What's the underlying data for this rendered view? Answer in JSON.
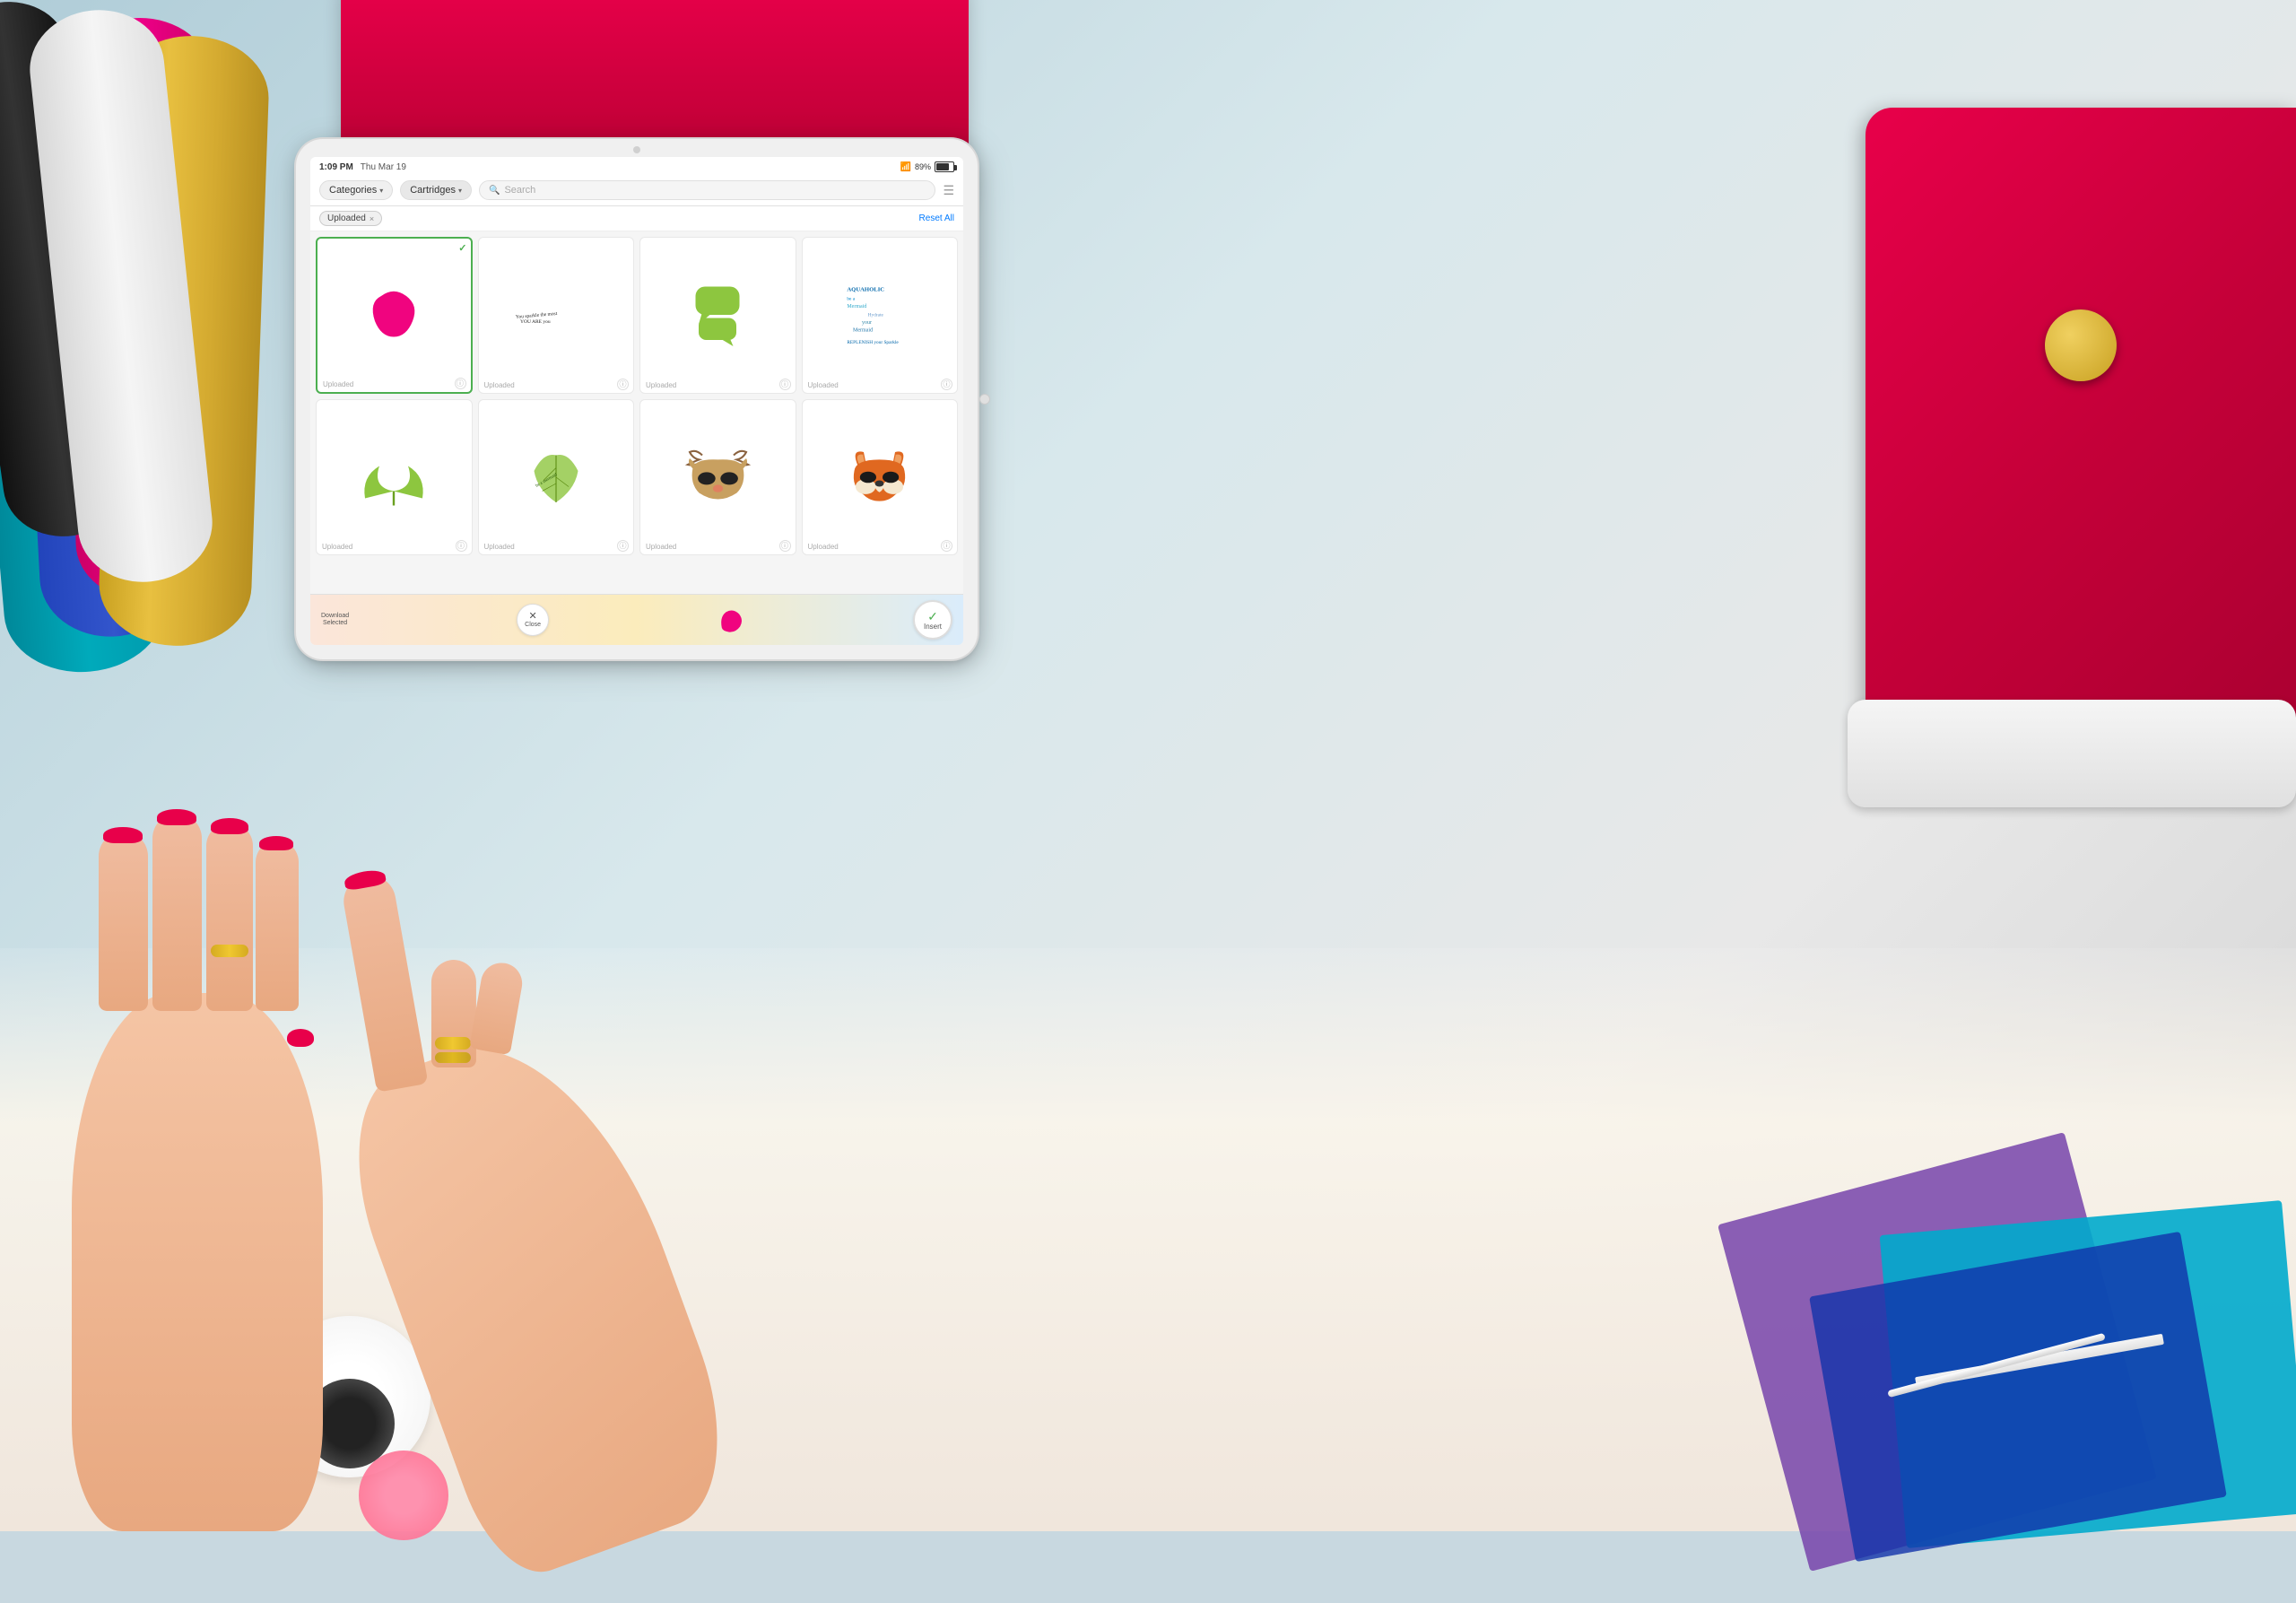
{
  "background": {
    "gradient_start": "#b8d0da",
    "gradient_end": "#e0e0e0"
  },
  "status_bar": {
    "time": "1:09 PM",
    "date": "Thu Mar 19",
    "wifi": "WiFi",
    "battery": "89%",
    "battery_icon": "▮▮▮▮"
  },
  "nav": {
    "categories_label": "Categories",
    "cartridges_label": "Cartridges",
    "categories_arrow": "▾",
    "cartridges_arrow": "▾",
    "search_placeholder": "Search",
    "filter_icon": "≡"
  },
  "filter_bar": {
    "tag_label": "Uploaded",
    "tag_close": "×",
    "reset_label": "Reset All"
  },
  "grid": {
    "cells": [
      {
        "id": "cell-1",
        "label": "Uploaded",
        "selected": true,
        "has_check": true,
        "image_type": "pink-blob"
      },
      {
        "id": "cell-2",
        "label": "Uploaded",
        "selected": false,
        "has_check": false,
        "image_type": "text-script"
      },
      {
        "id": "cell-3",
        "label": "Uploaded",
        "selected": false,
        "has_check": false,
        "image_type": "speech-bubbles"
      },
      {
        "id": "cell-4",
        "label": "Uploaded",
        "selected": false,
        "has_check": false,
        "image_type": "mermaid-text"
      },
      {
        "id": "cell-5",
        "label": "Uploaded",
        "selected": false,
        "has_check": false,
        "image_type": "leaves"
      },
      {
        "id": "cell-6",
        "label": "Uploaded",
        "selected": false,
        "has_check": false,
        "image_type": "leaf-script"
      },
      {
        "id": "cell-7",
        "label": "Uploaded",
        "selected": false,
        "has_check": false,
        "image_type": "deer-mask"
      },
      {
        "id": "cell-8",
        "label": "Uploaded",
        "selected": false,
        "has_check": false,
        "image_type": "fox-mask"
      }
    ]
  },
  "bottom_bar": {
    "download_line1": "Download",
    "download_line2": "Selected",
    "close_label": "Close",
    "close_icon": "×",
    "insert_label": "Insert",
    "insert_icon": "✓"
  }
}
